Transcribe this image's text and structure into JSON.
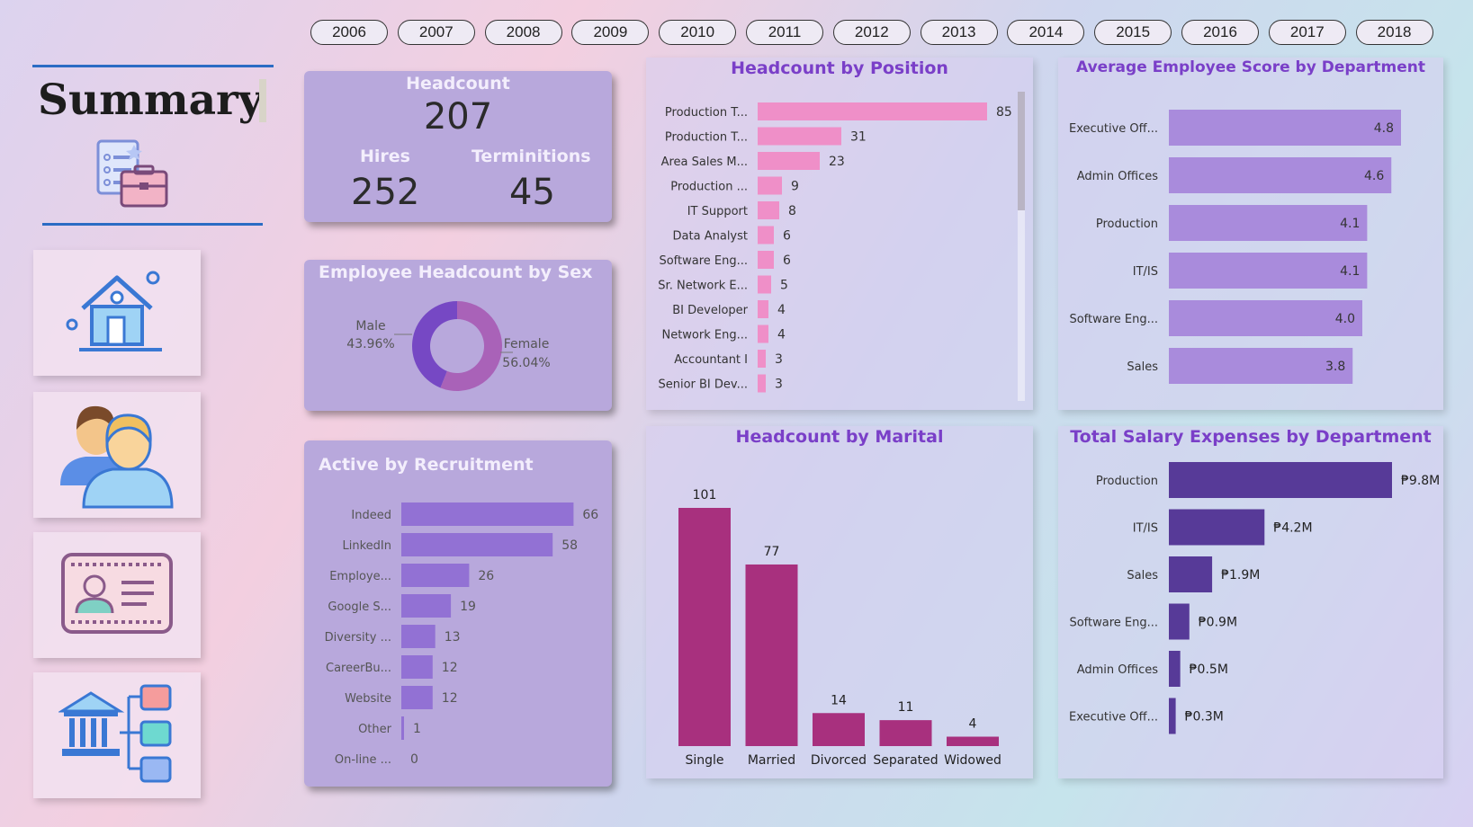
{
  "years": [
    "2006",
    "2007",
    "2008",
    "2009",
    "2010",
    "2011",
    "2012",
    "2013",
    "2014",
    "2015",
    "2016",
    "2017",
    "2018"
  ],
  "summary": {
    "title": "Summary"
  },
  "nav_tiles": [
    {
      "icon": "home-icon"
    },
    {
      "icon": "employees-icon"
    },
    {
      "icon": "id-card-icon"
    },
    {
      "icon": "department-icon"
    }
  ],
  "kpi": {
    "headcount_label": "Headcount",
    "headcount": "207",
    "hires_label": "Hires",
    "hires": "252",
    "terminations_label": "Terminitions",
    "terminations": "45"
  },
  "colors": {
    "position_bar": "#ef8fc8",
    "score_bar": "#a98bdc",
    "recruit_bar": "#9271d4",
    "marital_bar": "#a8307e",
    "salary_bar": "#573a98",
    "donut_male": "#7648c4",
    "donut_female": "#a962b8",
    "title_accent": "#7a3fc8"
  },
  "chart_data": [
    {
      "id": "sex",
      "type": "pie",
      "title": "Employee Headcount by Sex",
      "slices": [
        {
          "label": "Male",
          "value": 43.96,
          "display": "43.96%"
        },
        {
          "label": "Female",
          "value": 56.04,
          "display": "56.04%"
        }
      ]
    },
    {
      "id": "recruitment",
      "type": "bar",
      "orientation": "horizontal",
      "title": "Active by Recruitment",
      "categories": [
        "Indeed",
        "LinkedIn",
        "Employe...",
        "Google S...",
        "Diversity ...",
        "CareerBu...",
        "Website",
        "Other",
        "On-line ..."
      ],
      "values": [
        66,
        58,
        26,
        19,
        13,
        12,
        12,
        1,
        0
      ],
      "labels": [
        "66",
        "58",
        "26",
        "19",
        "13",
        "12",
        "12",
        "1",
        "0"
      ],
      "xlim": [
        0,
        70
      ]
    },
    {
      "id": "position",
      "type": "bar",
      "orientation": "horizontal",
      "title": "Headcount by Position",
      "categories": [
        "Production T...",
        "Production T...",
        "Area Sales M...",
        "Production ...",
        "IT Support",
        "Data Analyst",
        "Software Eng...",
        "Sr. Network E...",
        "BI Developer",
        "Network Eng...",
        "Accountant I",
        "Senior BI Dev..."
      ],
      "values": [
        85,
        31,
        23,
        9,
        8,
        6,
        6,
        5,
        4,
        4,
        3,
        3
      ],
      "labels": [
        "85",
        "31",
        "23",
        "9",
        "8",
        "6",
        "6",
        "5",
        "4",
        "4",
        "3",
        "3"
      ],
      "xlim": [
        0,
        85
      ]
    },
    {
      "id": "score",
      "type": "bar",
      "orientation": "horizontal",
      "title": "Average Employee Score by Department",
      "categories": [
        "Executive Off...",
        "Admin Offices",
        "Production",
        "IT/IS",
        "Software Eng...",
        "Sales"
      ],
      "values": [
        4.8,
        4.6,
        4.1,
        4.1,
        4.0,
        3.8
      ],
      "labels": [
        "4.8",
        "4.6",
        "4.1",
        "4.1",
        "4.0",
        "3.8"
      ],
      "xlim": [
        0,
        4.8
      ]
    },
    {
      "id": "marital",
      "type": "bar",
      "orientation": "vertical",
      "title": "Headcount by Marital",
      "categories": [
        "Single",
        "Married",
        "Divorced",
        "Separated",
        "Widowed"
      ],
      "values": [
        101,
        77,
        14,
        11,
        4
      ],
      "labels": [
        "101",
        "77",
        "14",
        "11",
        "4"
      ],
      "ylim": [
        0,
        101
      ]
    },
    {
      "id": "salary",
      "type": "bar",
      "orientation": "horizontal",
      "title": "Total Salary Expenses by Department",
      "categories": [
        "Production",
        "IT/IS",
        "Sales",
        "Software Eng...",
        "Admin Offices",
        "Executive Off..."
      ],
      "values": [
        9.8,
        4.2,
        1.9,
        0.9,
        0.5,
        0.3
      ],
      "labels": [
        "₱9.8M",
        "₱4.2M",
        "₱1.9M",
        "₱0.9M",
        "₱0.5M",
        "₱0.3M"
      ],
      "xlim": [
        0,
        9.8
      ]
    }
  ]
}
